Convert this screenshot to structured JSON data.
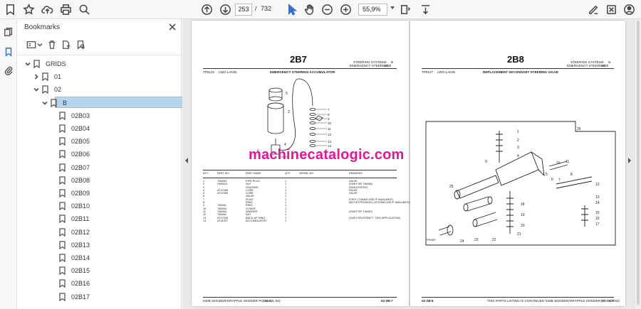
{
  "toolbar": {
    "page_current": "253",
    "page_separator": "/",
    "page_total": "732",
    "zoom_level": "55,9%"
  },
  "bookmarks": {
    "title": "Bookmarks",
    "items": [
      {
        "label": "GRIDS"
      },
      {
        "label": "01"
      },
      {
        "label": "02"
      },
      {
        "label": "B"
      },
      {
        "label": "02B03"
      },
      {
        "label": "02B04"
      },
      {
        "label": "02B05"
      },
      {
        "label": "02B06"
      },
      {
        "label": "02B07"
      },
      {
        "label": "02B08"
      },
      {
        "label": "02B09"
      },
      {
        "label": "02B10"
      },
      {
        "label": "02B11"
      },
      {
        "label": "02B12"
      },
      {
        "label": "02B13"
      },
      {
        "label": "02B14"
      },
      {
        "label": "02B15"
      },
      {
        "label": "02B16"
      },
      {
        "label": "02B17"
      }
    ]
  },
  "document": {
    "watermark": "machinecatalogic.com",
    "left_page": {
      "grid_id": "2B7",
      "section": "STEERING SYSTEMS",
      "section_num": "B",
      "subsection": "EMERGENCY STEERING",
      "subsection_num": "2000",
      "header_code": "TP8122",
      "header_note": "LWO-LANIN",
      "figure_title": "EMERGENCY STEERING ACCUMULATOR",
      "figure_ref": "LV6177",
      "columns": [
        "KEY",
        "PART NO.",
        "PART NAME",
        "QTY",
        "SERIAL NO.",
        "REMARKS"
      ],
      "rows": [
        {
          "key": "1",
          "part": "T46460",
          "name": "PIPE PLUG",
          "remark": "VALVE"
        },
        {
          "key": "2",
          "part": "HH8915",
          "name": "NUT",
          "remark": "(SUB FOR T46460)"
        },
        {
          "key": "3",
          "part": "",
          "name": "HOUSING",
          "remark": "(SUB AT41037)"
        },
        {
          "key": "4",
          "part": "AT47055",
          "name": "CORE",
          "remark": "VALVE"
        },
        {
          "key": "5",
          "part": "AT47060",
          "name": "CORE",
          "remark": "VALVE"
        },
        {
          "key": "6",
          "part": "",
          "name": "VALVE",
          "remark": ""
        },
        {
          "key": "7",
          "part": "",
          "name": "PLUG",
          "remark": "FORY ( T46460 USE IF AVAILABLE)"
        },
        {
          "key": "8",
          "part": "",
          "name": "RING",
          "remark": "ANTI-EXTRUSION ( AT47058 USE IF AVAILABLE)"
        },
        {
          "key": "9",
          "part": "T46461",
          "name": "RING",
          "remark": ""
        },
        {
          "key": "10",
          "part": "T46463",
          "name": "O-RING",
          "remark": ""
        },
        {
          "key": "11",
          "part": "T46464",
          "name": "WASHER",
          "remark": "(SUB FOR T46467)"
        },
        {
          "key": "12",
          "part": "T46461",
          "name": "NUT",
          "remark": ""
        },
        {
          "key": "13",
          "part": "AT17026",
          "name": "BACK-UP RING",
          "remark": "(SUB FOR AT35877, TWO APPLICATION)"
        },
        {
          "key": "14",
          "part": "AT41037",
          "name": "ACCUMULATOR",
          "remark": ""
        }
      ],
      "footer_left": "540B SKIDDER/GRAPPLE SKIDDER  PC-1624",
      "footer_date": "(25-JUL-92)",
      "footer_right": "02-2B-7"
    },
    "right_page": {
      "grid_id": "2B8",
      "section": "STEERING SYSTEMS",
      "section_num": "B",
      "subsection": "EMERGENCY STEERING",
      "subsection_num": "2000",
      "header_code": "TP8147",
      "header_note": "LWO-LANIN",
      "figure_title": "REPLACEMENT SECONDARY STEERING VALVE",
      "figure_ref": "TP6367",
      "callouts": [
        "1",
        "2",
        "3",
        "4",
        "5",
        "6",
        "7",
        "8",
        "9",
        "10",
        "11",
        "12",
        "13",
        "14",
        "15",
        "16",
        "17",
        "18",
        "19",
        "20",
        "21",
        "22",
        "23",
        "24",
        "25",
        "26"
      ],
      "footer_left": "02-2B-8",
      "footer_mid": "THIS PARTS LISTING IS CONTINUED",
      "footer_right": "540B SKIDDER/GRAPPLE SKIDDER  PC-1624",
      "footer_date": "(25-OCT-92)"
    }
  }
}
